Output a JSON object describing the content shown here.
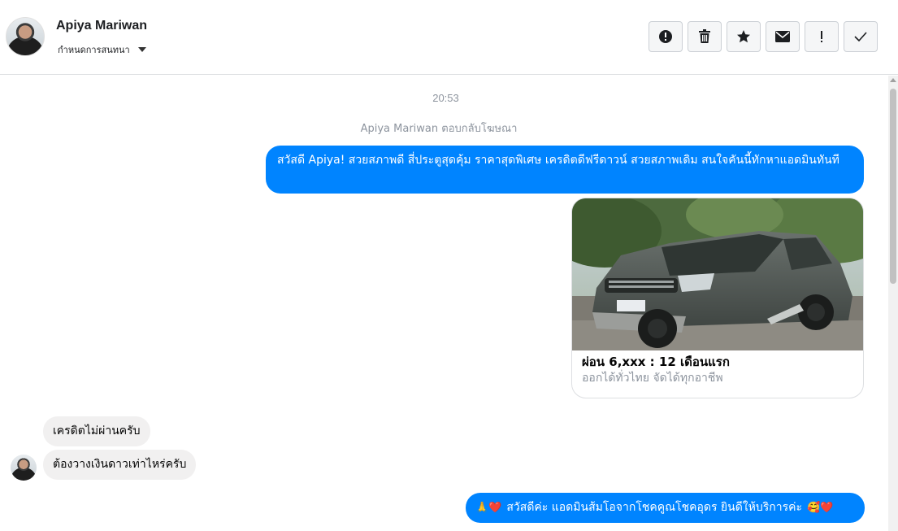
{
  "header": {
    "contact_name": "Apiya Mariwan",
    "conversation_settings_label": "กำหนดการสนทนา",
    "toolbar_icons": [
      "alert-circle-icon",
      "trash-icon",
      "star-icon",
      "envelope-icon",
      "exclamation-icon",
      "check-icon"
    ]
  },
  "chat": {
    "timestamp": "20:53",
    "reply_note": "Apiya Mariwan ตอบกลับโฆษณา",
    "messages_out": [
      {
        "text": "สวัสดี Apiya! สวยสภาพดี สี่ประตูสุดคุ้ม ราคาสุดพิเศษ เครดิตดีฟรีดาวน์ สวยสภาพเดิม สนใจคันนี้ทักหาแอดมินทันที"
      }
    ],
    "ad_card": {
      "title": "ผ่อน 6,xxx : 12 เดือนแรก",
      "subtitle": "ออกได้ทั่วไทย จัดได้ทุกอาชีพ"
    },
    "messages_in": [
      {
        "text": "เครดิตไม่ผ่านครับ"
      },
      {
        "text": "ต้องวางเงินดาวเท่าไหร่ครับ"
      }
    ],
    "reply_out": {
      "leading_emoji": "🙏❤️",
      "text": "สวัสดีค่ะ แอดมินส้มโอจากโชคคูณโชคอุดร ยินดีให้บริการค่ะ",
      "trailing_emoji": "🥰❤️"
    }
  },
  "colors": {
    "outgoing_bubble": "#0084ff",
    "incoming_bubble": "#f1f0f0",
    "muted_text": "#8d949e"
  }
}
